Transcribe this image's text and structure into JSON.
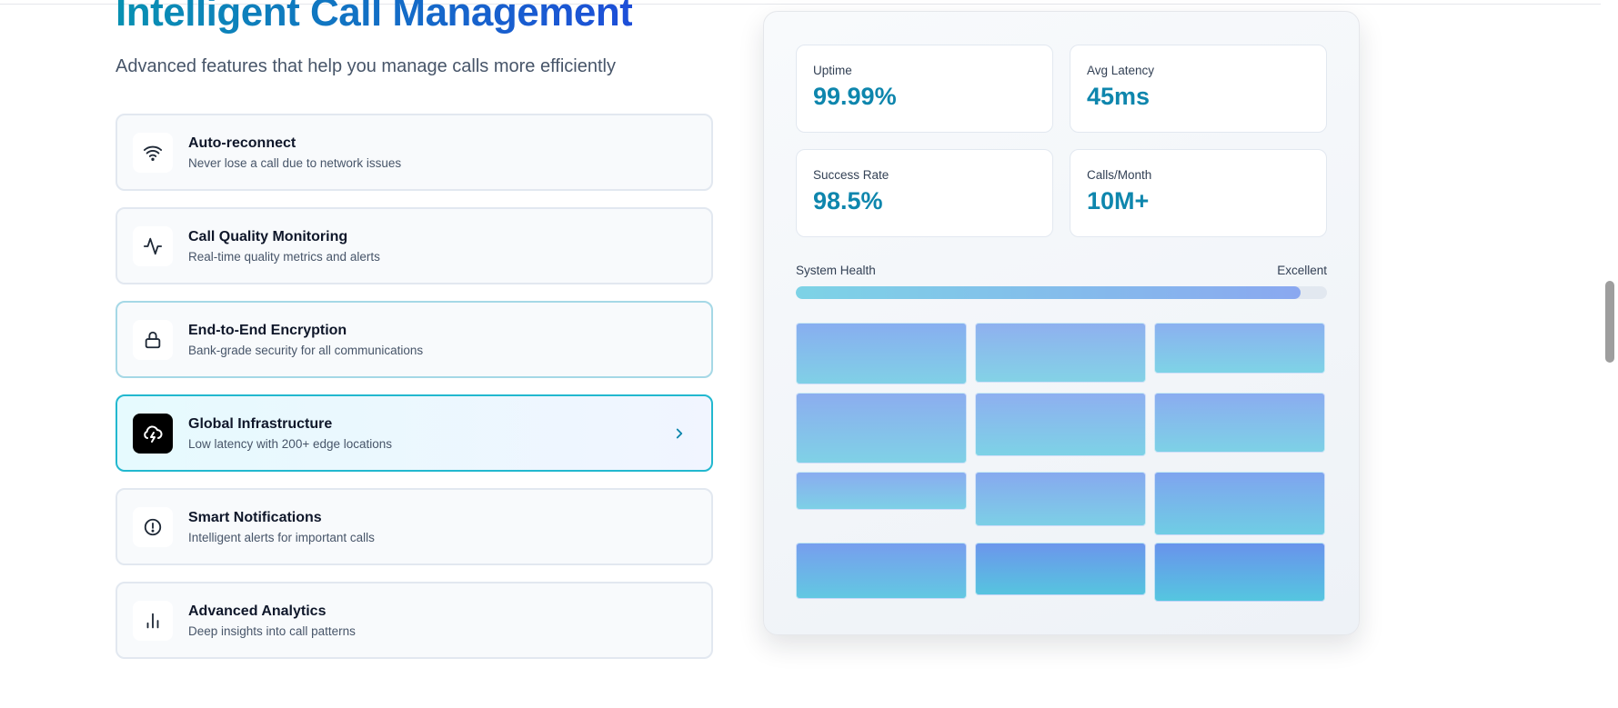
{
  "header": {
    "title": "Intelligent Call Management",
    "subtitle": "Advanced features that help you manage calls more efficiently"
  },
  "features": [
    {
      "title": "Auto-reconnect",
      "description": "Never lose a call due to network issues",
      "icon": "wifi-icon"
    },
    {
      "title": "Call Quality Monitoring",
      "description": "Real-time quality metrics and alerts",
      "icon": "activity-icon"
    },
    {
      "title": "End-to-End Encryption",
      "description": "Bank-grade security for all communications",
      "icon": "lock-icon"
    },
    {
      "title": "Global Infrastructure",
      "description": "Low latency with 200+ edge locations",
      "icon": "cloud-lightning-icon"
    },
    {
      "title": "Smart Notifications",
      "description": "Intelligent alerts for important calls",
      "icon": "alert-circle-icon"
    },
    {
      "title": "Advanced Analytics",
      "description": "Deep insights into call patterns",
      "icon": "bar-chart-icon"
    }
  ],
  "active_feature": "Global Infrastructure",
  "stats": [
    {
      "label": "Uptime",
      "value": "99.99%"
    },
    {
      "label": "Avg Latency",
      "value": "45ms"
    },
    {
      "label": "Success Rate",
      "value": "98.5%"
    },
    {
      "label": "Calls/Month",
      "value": "10M+"
    }
  ],
  "health": {
    "label": "System Health",
    "status": "Excellent",
    "level_fraction": 0.95
  },
  "colors": {
    "accent": "#0e86ad",
    "title_gradient_start": "#0891b2",
    "title_gradient_end": "#1d4ed8",
    "active_border": "#22b8cf"
  }
}
